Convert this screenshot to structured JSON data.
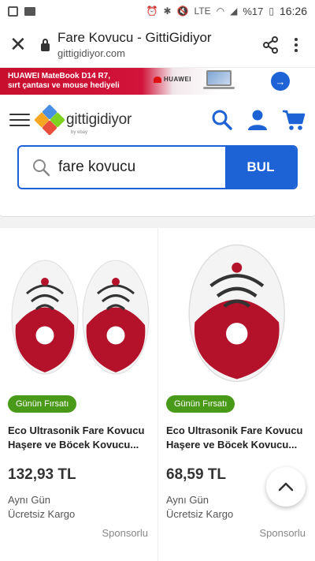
{
  "status_bar": {
    "battery": "%17",
    "time": "16:26",
    "network": "LTE"
  },
  "browser": {
    "title": "Fare Kovucu - GittiGidiyor",
    "url": "gittigidiyor.com"
  },
  "banner": {
    "line1": "HUAWEI MateBook D14 R7,",
    "line2": "sırt çantası ve mouse hediyeli",
    "brand": "HUAWEI"
  },
  "header": {
    "logo_text": "gittigidiyor",
    "logo_sub": "by ebay"
  },
  "search": {
    "value": "fare kovucu",
    "button_label": "BUL"
  },
  "products": [
    {
      "badge": "Günün Fırsatı",
      "name_line1": "Eco Ultrasonik Fare Kovucu",
      "name_line2": "Haşere ve Böcek Kovucu...",
      "price": "132,93 TL",
      "ship_line1": "Aynı Gün",
      "ship_line2": "Ücretsiz Kargo",
      "sponsored": "Sponsorlu"
    },
    {
      "badge": "Günün Fırsatı",
      "name_line1": "Eco Ultrasonik Fare Kovucu",
      "name_line2": "Haşere ve Böcek Kovucu...",
      "price": "68,59 TL",
      "ship_line1": "Aynı Gün",
      "ship_line2": "Ücretsiz Kargo",
      "sponsored": "Sponsorlu"
    }
  ],
  "colors": {
    "primary": "#1e63d5",
    "badge": "#4a9a1a",
    "product_red": "#b3122a"
  }
}
